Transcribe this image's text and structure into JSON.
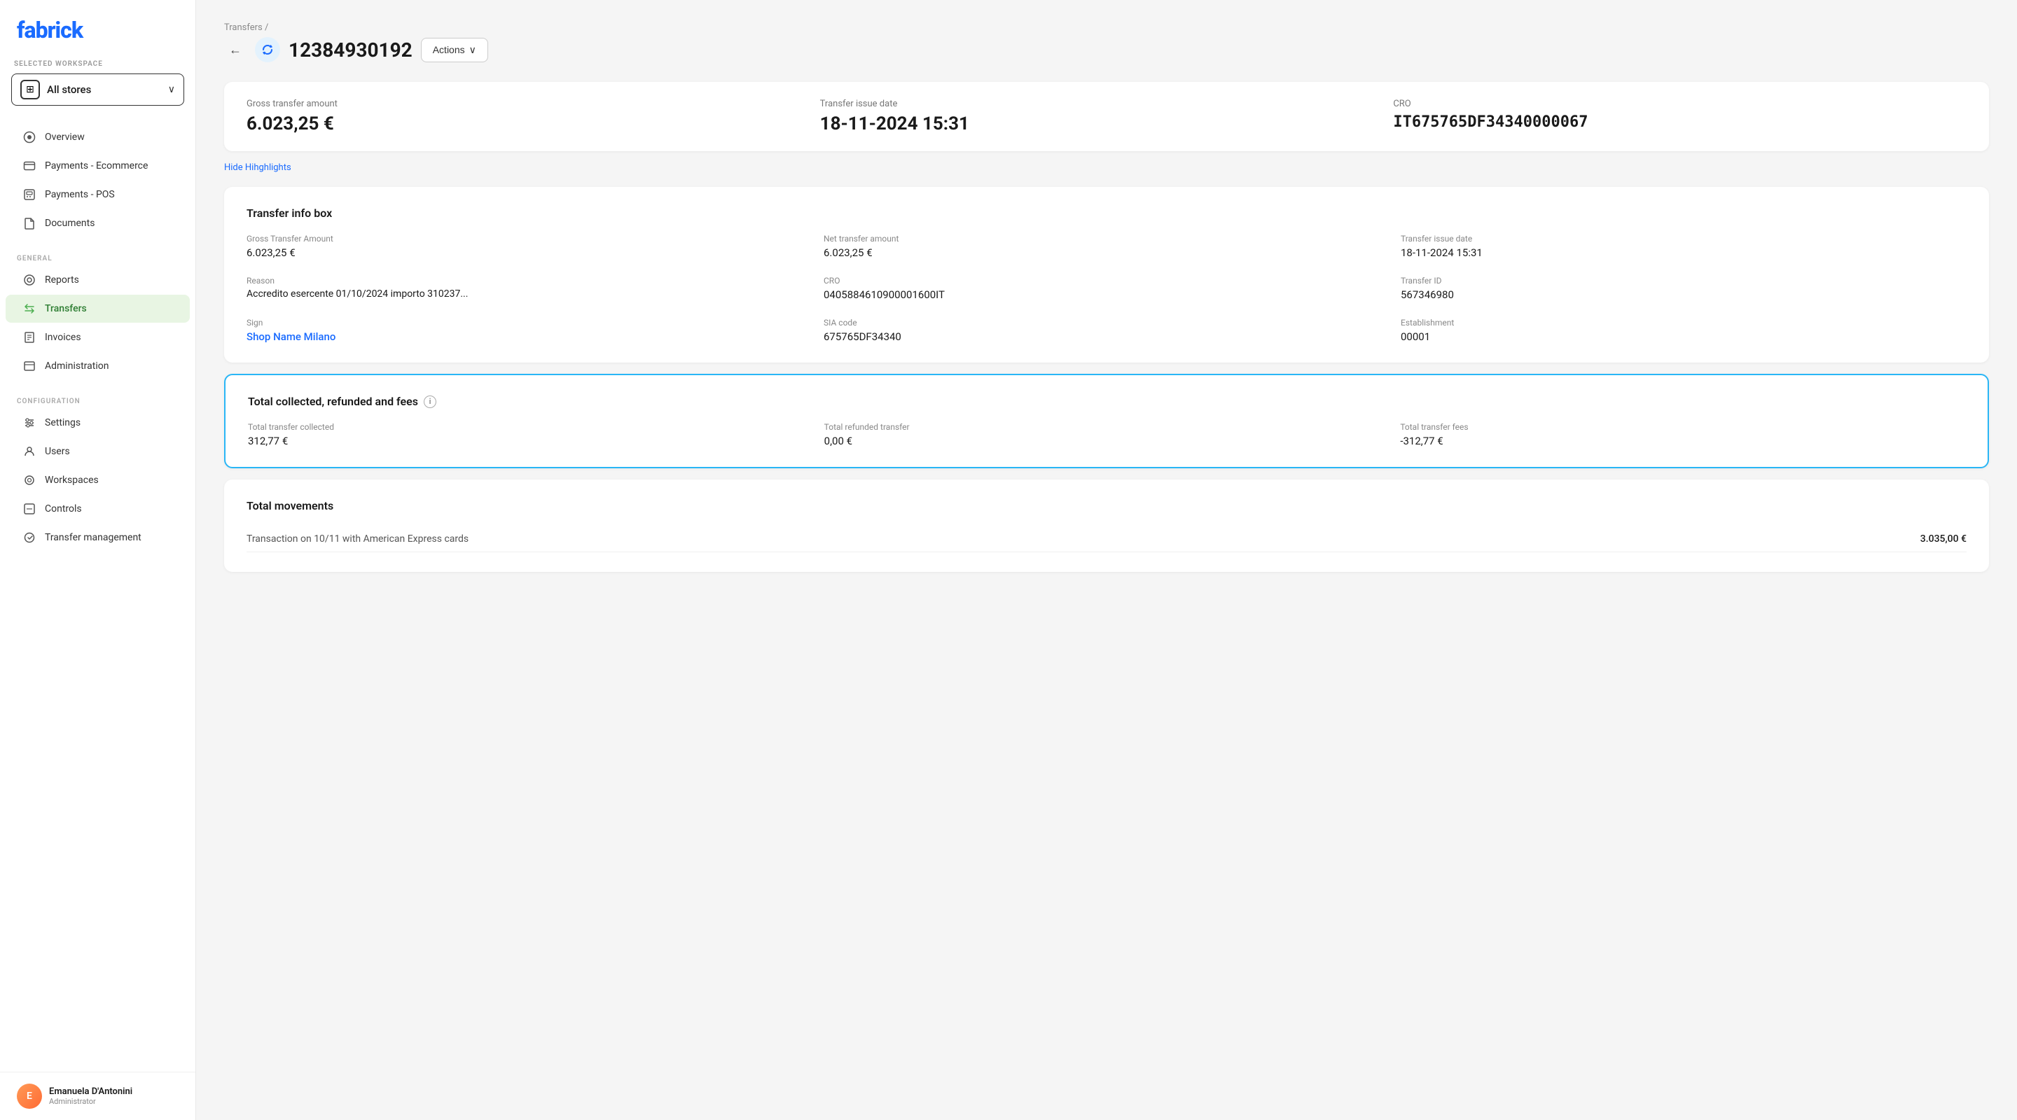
{
  "sidebar": {
    "logo": "fabrick",
    "workspace": {
      "label": "SELECTED WORKSPACE",
      "name": "All stores",
      "icon": "⊞"
    },
    "nav_items": [
      {
        "id": "overview",
        "label": "Overview",
        "icon": "○",
        "active": false,
        "section": null
      },
      {
        "id": "payments-ecommerce",
        "label": "Payments - Ecommerce",
        "icon": "⬜",
        "active": false,
        "section": null
      },
      {
        "id": "payments-pos",
        "label": "Payments - POS",
        "icon": "▦",
        "active": false,
        "section": null
      },
      {
        "id": "documents",
        "label": "Documents",
        "icon": "📄",
        "active": false,
        "section": null
      },
      {
        "id": "reports",
        "label": "Reports",
        "icon": "◎",
        "active": false,
        "section": "GENERAL"
      },
      {
        "id": "transfers",
        "label": "Transfers",
        "icon": "⇄",
        "active": true,
        "section": null
      },
      {
        "id": "invoices",
        "label": "Invoices",
        "icon": "🗒",
        "active": false,
        "section": null
      },
      {
        "id": "administration",
        "label": "Administration",
        "icon": "📖",
        "active": false,
        "section": null
      },
      {
        "id": "settings",
        "label": "Settings",
        "icon": "⚙",
        "active": false,
        "section": "CONFIGURATION"
      },
      {
        "id": "users",
        "label": "Users",
        "icon": "👤",
        "active": false,
        "section": null
      },
      {
        "id": "workspaces",
        "label": "Workspaces",
        "icon": "◎",
        "active": false,
        "section": null
      },
      {
        "id": "controls",
        "label": "Controls",
        "icon": "⊟",
        "active": false,
        "section": null
      },
      {
        "id": "transfer-management",
        "label": "Transfer management",
        "icon": "⚙",
        "active": false,
        "section": null
      }
    ],
    "user": {
      "name": "Emanuela D'Antonini",
      "role": "Administrator",
      "initials": "E"
    }
  },
  "breadcrumb": "Transfers /",
  "header": {
    "transfer_id": "12384930192",
    "actions_label": "Actions"
  },
  "highlights": {
    "gross_transfer_amount_label": "Gross transfer amount",
    "gross_transfer_amount_value": "6.023,25 €",
    "transfer_issue_date_label": "Transfer issue date",
    "transfer_issue_date_value": "18-11-2024 15:31",
    "cro_label": "CRO",
    "cro_value": "IT675765DF34340000067",
    "hide_highlights_label": "Hide Hihghlights"
  },
  "transfer_info_box": {
    "title": "Transfer info box",
    "fields": [
      {
        "label": "Gross Transfer Amount",
        "value": "6.023,25 €",
        "type": "normal"
      },
      {
        "label": "Net transfer amount",
        "value": "6.023,25 €",
        "type": "normal"
      },
      {
        "label": "Transfer issue date",
        "value": "18-11-2024 15:31",
        "type": "normal"
      },
      {
        "label": "Reason",
        "value": "Accredito esercente 01/10/2024 importo 310237...",
        "type": "truncated"
      },
      {
        "label": "CRO",
        "value": "0405884610900001600IT",
        "type": "normal"
      },
      {
        "label": "Transfer ID",
        "value": "567346980",
        "type": "normal"
      },
      {
        "label": "Sign",
        "value": "Shop Name Milano",
        "type": "link"
      },
      {
        "label": "SIA code",
        "value": "675765DF34340",
        "type": "normal"
      },
      {
        "label": "Establishment",
        "value": "00001",
        "type": "normal"
      }
    ]
  },
  "total_collected": {
    "title": "Total collected, refunded and fees",
    "total_transfer_collected_label": "Total transfer collected",
    "total_transfer_collected_value": "312,77 €",
    "total_refunded_transfer_label": "Total refunded transfer",
    "total_refunded_transfer_value": "0,00 €",
    "total_transfer_fees_label": "Total transfer fees",
    "total_transfer_fees_value": "-312,77 €"
  },
  "total_movements": {
    "title": "Total movements",
    "rows": [
      {
        "label": "Transaction on 10/11 with American Express cards",
        "value": "3.035,00 €"
      }
    ]
  }
}
